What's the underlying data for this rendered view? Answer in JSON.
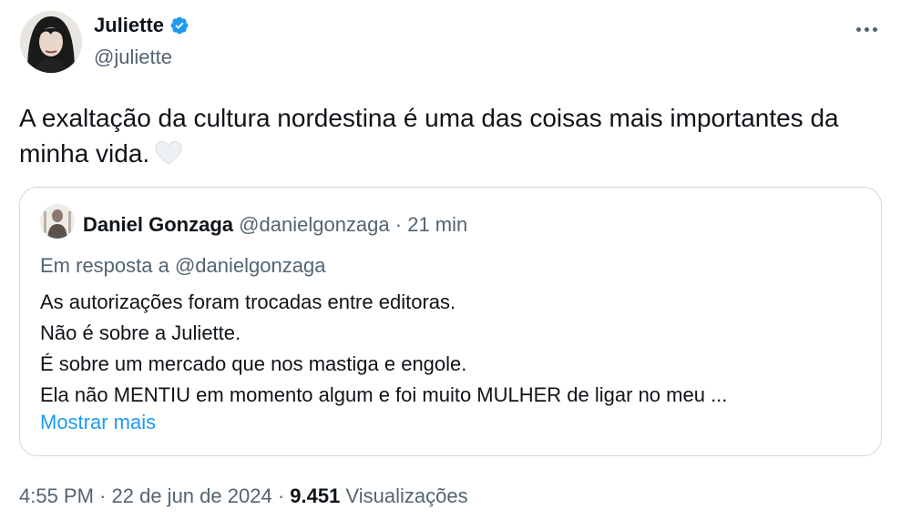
{
  "author": {
    "name": "Juliette",
    "handle": "@juliette",
    "verified": true,
    "verified_color": "#1d9bf0"
  },
  "tweet": {
    "text": "A exaltação da cultura nordestina é uma das coisas mais importantes da minha vida.",
    "emoji": "white-heart-icon"
  },
  "quote": {
    "name": "Daniel Gonzaga",
    "handle": "@danielgonzaga",
    "separator": "·",
    "time": "21 min",
    "reply_prefix": "Em resposta a",
    "reply_handle": "@danielgonzaga",
    "lines": [
      "As autorizações foram trocadas entre editoras.",
      "Não é sobre a Juliette.",
      "É sobre um mercado que nos mastiga e engole.",
      "Ela não MENTIU em momento algum e foi muito MULHER de ligar no meu ..."
    ],
    "show_more": "Mostrar mais"
  },
  "footer": {
    "time": "4:55 PM",
    "sep1": "·",
    "date": "22 de jun de 2024",
    "sep2": "·",
    "views_count": "9.451",
    "views_label": "Visualizações"
  },
  "colors": {
    "text": "#0f1419",
    "secondary": "#536471",
    "link": "#1d9bf0",
    "border": "#cfd9de"
  }
}
